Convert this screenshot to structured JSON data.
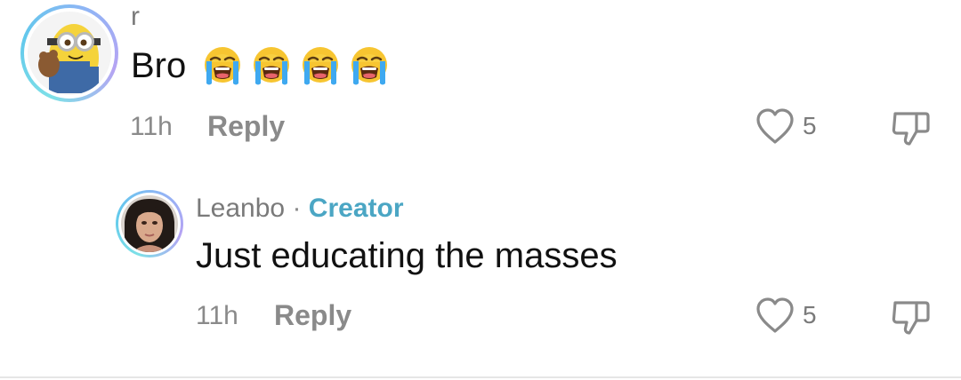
{
  "comments": [
    {
      "username": "r",
      "text": "Bro",
      "emoji": [
        "loudly-crying-face",
        "loudly-crying-face",
        "loudly-crying-face",
        "loudly-crying-face"
      ],
      "time": "11h",
      "reply_label": "Reply",
      "likes": "5"
    },
    {
      "username": "Leanbo",
      "separator": "·",
      "badge": "Creator",
      "text": "Just educating the masses",
      "time": "11h",
      "reply_label": "Reply",
      "likes": "5"
    }
  ],
  "colors": {
    "creator_badge": "#4ba6c4",
    "meta_gray": "#8a8a8a",
    "text": "#111111",
    "avatar_ring": "#62c8ec"
  }
}
